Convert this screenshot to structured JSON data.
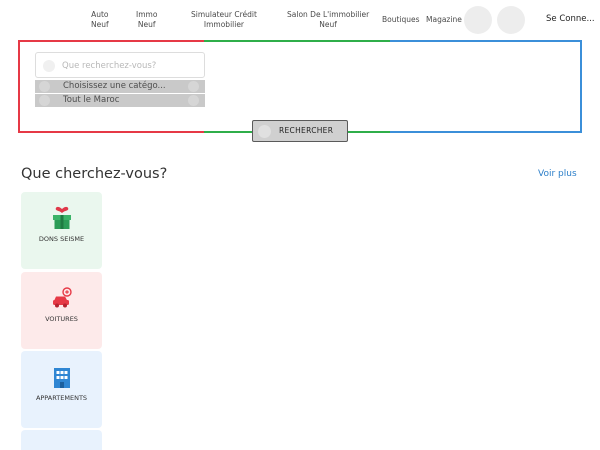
{
  "nav": {
    "items": [
      {
        "label": "Auto\nNeuf"
      },
      {
        "label": "Immo\nNeuf"
      },
      {
        "label": "Simulateur Crédit\nImmobilier"
      },
      {
        "label": "Salon De L'immobilier\nNeuf"
      },
      {
        "label": "Boutiques"
      },
      {
        "label": "Magazine"
      }
    ],
    "signin_label": "Se Conne..."
  },
  "search": {
    "placeholder": "Que recherchez-vous?",
    "category_value": "Choisissez une catégo...",
    "city_value": "Tout le Maroc",
    "button_label": "RECHERCHER",
    "border_colors": [
      "#e63946",
      "#2fae4a",
      "#3b8fd9"
    ]
  },
  "section": {
    "title": "Que cherchez-vous?",
    "see_more": "Voir plus",
    "categories": [
      {
        "label": "DONS SEISME",
        "icon": "gift-heart-icon",
        "color": "#eaf7ee"
      },
      {
        "label": "VOITURES",
        "icon": "car-icon",
        "color": "#fdeaea"
      },
      {
        "label": "APPARTEMENTS",
        "icon": "building-icon",
        "color": "#e8f2fd"
      },
      {
        "label": "",
        "icon": "category-icon",
        "color": "#e8f2fd"
      }
    ]
  }
}
